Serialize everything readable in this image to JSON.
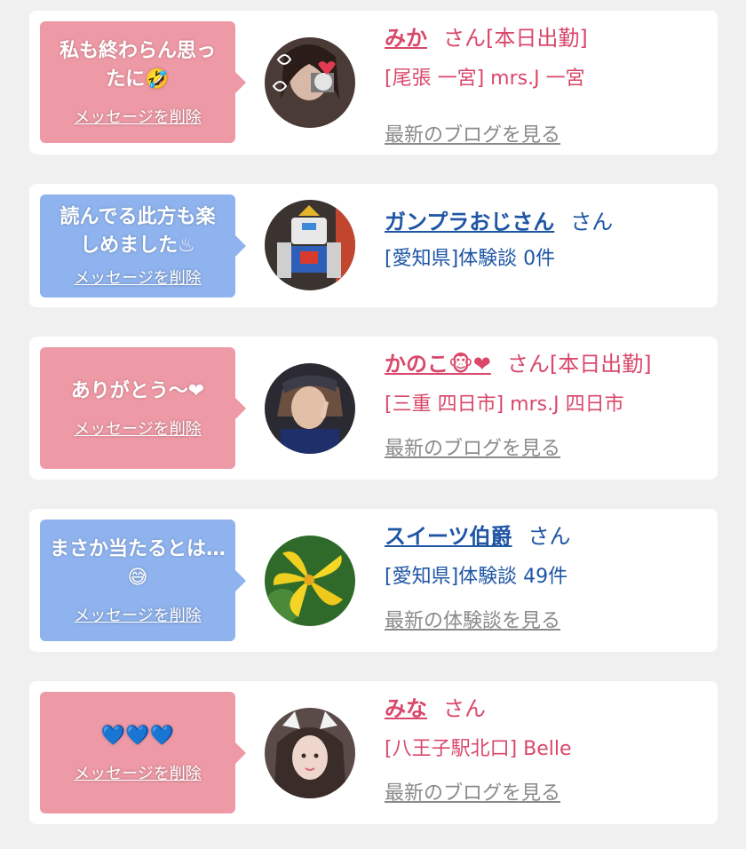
{
  "delete_label": "メッセージを削除",
  "colors": {
    "pink_bubble": "#ee9aa6",
    "blue_bubble": "#8fb3ee",
    "cast_text": "#d9486a",
    "user_text": "#1e55a5",
    "blog_link": "#8a8a8a"
  },
  "items": [
    {
      "message": "私も終わらん思っ\nたに🤣",
      "name": "みか",
      "honorific": "さん[本日出勤]",
      "location": "[尾張 一宮] mrs.J 一宮",
      "link": "最新のブログを見る"
    },
    {
      "message": "読んでる此方も楽\nしめました♨",
      "name": "ガンプラおじさん",
      "honorific": "さん",
      "location": "[愛知県]体験談 0件",
      "link": ""
    },
    {
      "message": "ありがとう〜❤",
      "name": "かのこ🐵❤",
      "honorific": "さん[本日出勤]",
      "location": "[三重 四日市] mrs.J 四日市",
      "link": "最新のブログを見る"
    },
    {
      "message": "まさか当たるとは…😅",
      "name": "スイーツ伯爵",
      "honorific": "さん",
      "location": "[愛知県]体験談 49件",
      "link": "最新の体験談を見る"
    },
    {
      "message": "💙💙💙",
      "name": "みな",
      "honorific": "さん",
      "location": "[八王子駅北口] Belle",
      "link": "最新のブログを見る"
    }
  ]
}
